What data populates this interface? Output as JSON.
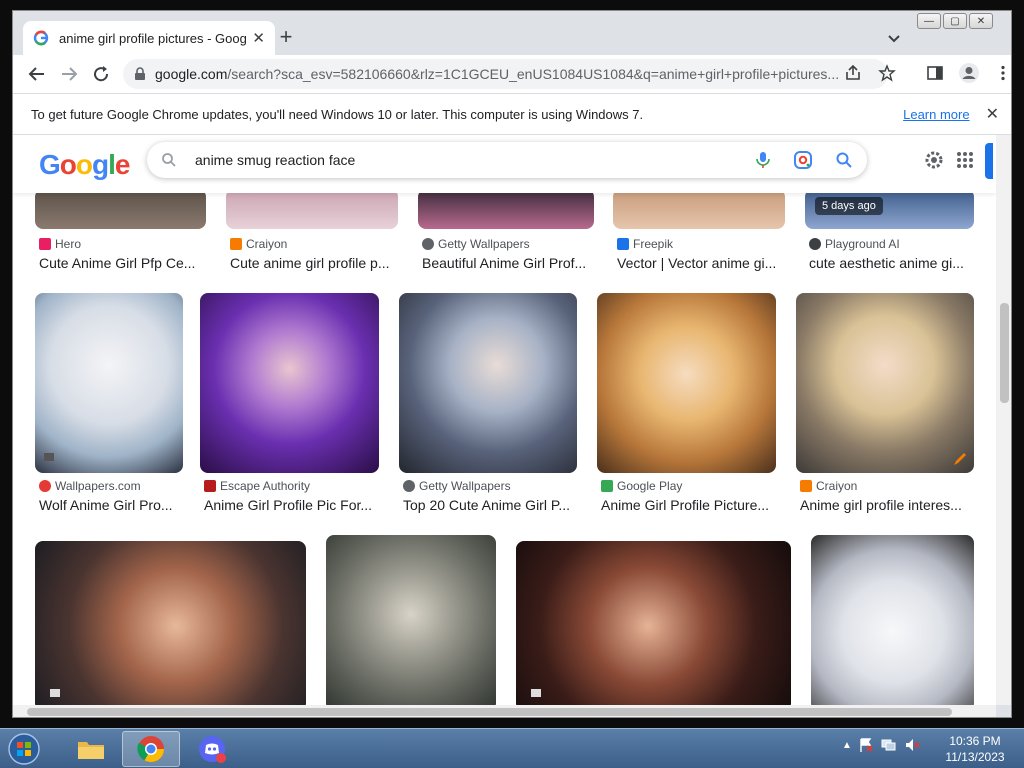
{
  "browser": {
    "tab_title": "anime girl profile pictures - Goog",
    "url_host": "google.com",
    "url_path": "/search?sca_esv=582106660&rlz=1C1GCEU_enUS1084US1084&q=anime+girl+profile+pictures..."
  },
  "infobar": {
    "message": "To get future Google Chrome updates, you'll need Windows 10 or later. This computer is using Windows 7.",
    "learn_more": "Learn more"
  },
  "google": {
    "logo": "Google",
    "query": "anime smug reaction face"
  },
  "rows": [
    {
      "items": [
        {
          "source": "Hero",
          "title": "Cute Anime Girl Pfp Ce...",
          "favicon": "#e91e63"
        },
        {
          "source": "Craiyon",
          "title": "Cute anime girl profile p...",
          "favicon": "#f57c00"
        },
        {
          "source": "Getty Wallpapers",
          "title": "Beautiful Anime Girl Prof...",
          "favicon": "#5f6368"
        },
        {
          "source": "Freepik",
          "title": "Vector | Vector anime gi...",
          "favicon": "#1a73e8"
        },
        {
          "source": "Playground AI",
          "title": "cute aesthetic anime gi...",
          "favicon": "#3c4043",
          "badge": "5 days ago"
        }
      ]
    },
    {
      "items": [
        {
          "source": "Wallpapers.com",
          "title": "Wolf Anime Girl Pro...",
          "favicon": "#e53935"
        },
        {
          "source": "Escape Authority",
          "title": "Anime Girl Profile Pic For...",
          "favicon": "#b71c1c"
        },
        {
          "source": "Getty Wallpapers",
          "title": "Top 20 Cute Anime Girl P...",
          "favicon": "#5f6368"
        },
        {
          "source": "Google Play",
          "title": "Anime Girl Profile Picture...",
          "favicon": "#34a853"
        },
        {
          "source": "Craiyon",
          "title": "Anime girl profile interes...",
          "favicon": "#f57c00"
        }
      ]
    }
  ],
  "taskbar": {
    "time": "10:36 PM",
    "date": "11/13/2023"
  }
}
